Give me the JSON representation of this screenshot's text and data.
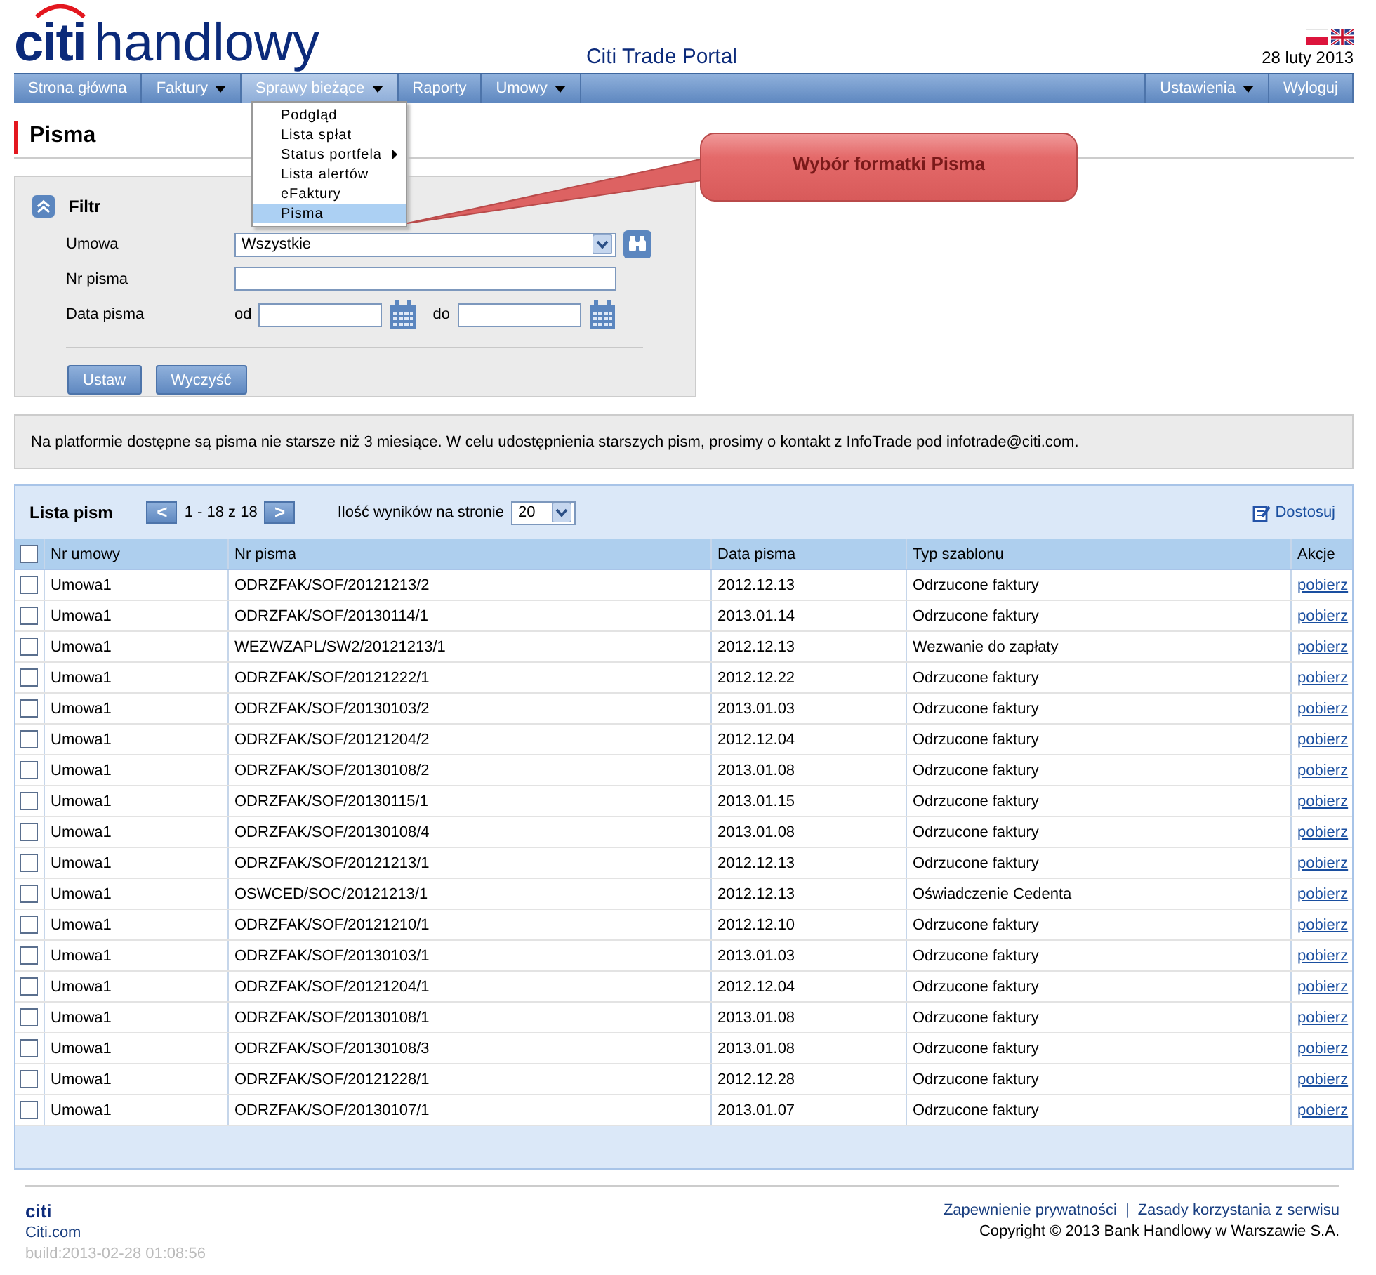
{
  "header": {
    "logo_brand": "citi",
    "logo_name": "handlowy",
    "portal_title": "Citi Trade Portal",
    "date": "28 luty 2013"
  },
  "nav": {
    "left": [
      {
        "label": "Strona główna",
        "has_menu": false,
        "selected": false
      },
      {
        "label": "Faktury",
        "has_menu": true,
        "selected": false
      },
      {
        "label": "Sprawy bieżące",
        "has_menu": true,
        "selected": true
      },
      {
        "label": "Raporty",
        "has_menu": false,
        "selected": false
      },
      {
        "label": "Umowy",
        "has_menu": true,
        "selected": false
      }
    ],
    "right": [
      {
        "label": "Ustawienia",
        "has_menu": true,
        "selected": false
      },
      {
        "label": "Wyloguj",
        "has_menu": false,
        "selected": false
      }
    ]
  },
  "dropdown": [
    {
      "label": "Podgląd",
      "submenu": false,
      "selected": false
    },
    {
      "label": "Lista spłat",
      "submenu": false,
      "selected": false
    },
    {
      "label": "Status portfela",
      "submenu": true,
      "selected": false
    },
    {
      "label": "Lista alertów",
      "submenu": false,
      "selected": false
    },
    {
      "label": "eFaktury",
      "submenu": false,
      "selected": false
    },
    {
      "label": "Pisma",
      "submenu": false,
      "selected": true
    }
  ],
  "callout": {
    "text": "Wybór formatki Pisma"
  },
  "page_title": "Pisma",
  "filter": {
    "title": "Filtr",
    "expanded": true,
    "umowa_label": "Umowa",
    "umowa_value": "Wszystkie",
    "nr_label": "Nr pisma",
    "date_label": "Data pisma",
    "from_label": "od",
    "to_label": "do",
    "buttons": [
      "Ustaw",
      "Wyczyść"
    ]
  },
  "info": "Na platformie dostępne są pisma nie starsze niż 3 miesiące. W celu udostępnienia starszych pism, prosimy o kontakt z InfoTrade pod infotrade@citi.com.",
  "list": {
    "title": "Lista pism",
    "prev": "<",
    "range": "1 - 18 z 18",
    "next": ">",
    "per_page_label": "Ilość wyników na stronie",
    "per_page": "20",
    "customize": "Dostosuj",
    "all_checked": false,
    "columns": [
      "Nr umowy",
      "Nr pisma",
      "Data pisma",
      "Typ szablonu",
      "Akcje"
    ],
    "rows": [
      {
        "checked": false,
        "cells": [
          "Umowa1",
          "ODRZFAK/SOF/20121213/2",
          "2012.12.13",
          "Odrzucone faktury"
        ],
        "action": "pobierz"
      },
      {
        "checked": false,
        "cells": [
          "Umowa1",
          "ODRZFAK/SOF/20130114/1",
          "2013.01.14",
          "Odrzucone faktury"
        ],
        "action": "pobierz"
      },
      {
        "checked": false,
        "cells": [
          "Umowa1",
          "WEZWZAPL/SW2/20121213/1",
          "2012.12.13",
          "Wezwanie do zapłaty"
        ],
        "action": "pobierz"
      },
      {
        "checked": false,
        "cells": [
          "Umowa1",
          "ODRZFAK/SOF/20121222/1",
          "2012.12.22",
          "Odrzucone faktury"
        ],
        "action": "pobierz"
      },
      {
        "checked": false,
        "cells": [
          "Umowa1",
          "ODRZFAK/SOF/20130103/2",
          "2013.01.03",
          "Odrzucone faktury"
        ],
        "action": "pobierz"
      },
      {
        "checked": false,
        "cells": [
          "Umowa1",
          "ODRZFAK/SOF/20121204/2",
          "2012.12.04",
          "Odrzucone faktury"
        ],
        "action": "pobierz"
      },
      {
        "checked": false,
        "cells": [
          "Umowa1",
          "ODRZFAK/SOF/20130108/2",
          "2013.01.08",
          "Odrzucone faktury"
        ],
        "action": "pobierz"
      },
      {
        "checked": false,
        "cells": [
          "Umowa1",
          "ODRZFAK/SOF/20130115/1",
          "2013.01.15",
          "Odrzucone faktury"
        ],
        "action": "pobierz"
      },
      {
        "checked": false,
        "cells": [
          "Umowa1",
          "ODRZFAK/SOF/20130108/4",
          "2013.01.08",
          "Odrzucone faktury"
        ],
        "action": "pobierz"
      },
      {
        "checked": false,
        "cells": [
          "Umowa1",
          "ODRZFAK/SOF/20121213/1",
          "2012.12.13",
          "Odrzucone faktury"
        ],
        "action": "pobierz"
      },
      {
        "checked": false,
        "cells": [
          "Umowa1",
          "OSWCED/SOC/20121213/1",
          "2012.12.13",
          "Oświadczenie Cedenta"
        ],
        "action": "pobierz"
      },
      {
        "checked": false,
        "cells": [
          "Umowa1",
          "ODRZFAK/SOF/20121210/1",
          "2012.12.10",
          "Odrzucone faktury"
        ],
        "action": "pobierz"
      },
      {
        "checked": false,
        "cells": [
          "Umowa1",
          "ODRZFAK/SOF/20130103/1",
          "2013.01.03",
          "Odrzucone faktury"
        ],
        "action": "pobierz"
      },
      {
        "checked": false,
        "cells": [
          "Umowa1",
          "ODRZFAK/SOF/20121204/1",
          "2012.12.04",
          "Odrzucone faktury"
        ],
        "action": "pobierz"
      },
      {
        "checked": false,
        "cells": [
          "Umowa1",
          "ODRZFAK/SOF/20130108/1",
          "2013.01.08",
          "Odrzucone faktury"
        ],
        "action": "pobierz"
      },
      {
        "checked": false,
        "cells": [
          "Umowa1",
          "ODRZFAK/SOF/20130108/3",
          "2013.01.08",
          "Odrzucone faktury"
        ],
        "action": "pobierz"
      },
      {
        "checked": false,
        "cells": [
          "Umowa1",
          "ODRZFAK/SOF/20121228/1",
          "2012.12.28",
          "Odrzucone faktury"
        ],
        "action": "pobierz"
      },
      {
        "checked": false,
        "cells": [
          "Umowa1",
          "ODRZFAK/SOF/20130107/1",
          "2013.01.07",
          "Odrzucone faktury"
        ],
        "action": "pobierz"
      }
    ]
  },
  "footer": {
    "logo": "citi",
    "site": "Citi.com",
    "build": "build:2013-02-28 01:08:56",
    "links": [
      "Zapewnienie prywatności",
      "Zasady korzystania z serwisu"
    ],
    "link_separator": "|",
    "copyright": "Copyright © 2013 Bank Handlowy w Warszawie S.A."
  }
}
